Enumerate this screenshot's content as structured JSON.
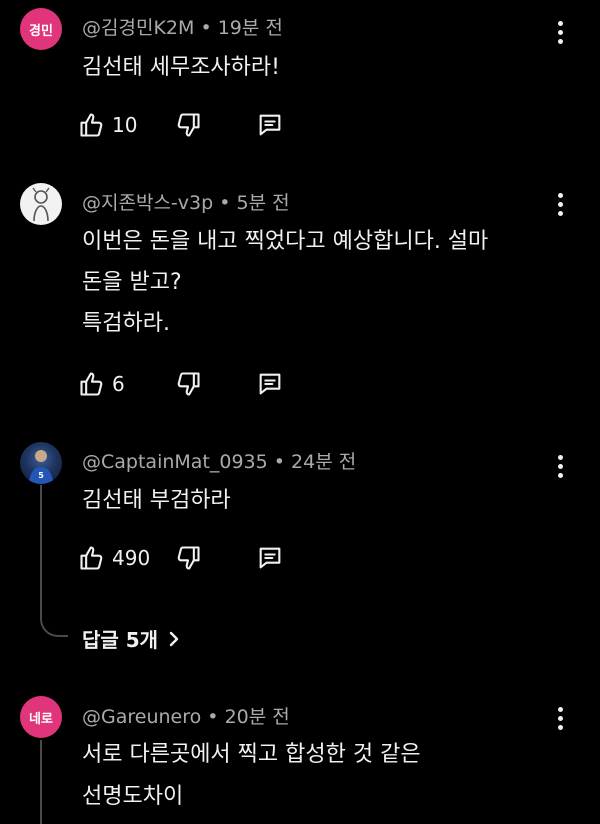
{
  "comments": [
    {
      "avatar_text": "경민",
      "handle": "@김경민K2M",
      "time": "19분 전",
      "lines": [
        "김선태 세무조사하라!"
      ],
      "likes": "10"
    },
    {
      "avatar_text": "",
      "handle": "@지존박스-v3p",
      "time": "5분 전",
      "lines": [
        "이번은 돈을 내고 찍었다고 예상합니다. 설마",
        "돈을 받고?",
        "특검하라."
      ],
      "likes": "6"
    },
    {
      "avatar_text": "",
      "handle": "@CaptainMat_0935",
      "time": "24분 전",
      "lines": [
        "김선태 부검하라"
      ],
      "likes": "490",
      "replies_label": "답글 5개"
    },
    {
      "avatar_text": "네로",
      "handle": "@Gareunero",
      "time": "20분 전",
      "lines": [
        "서로 다른곳에서 찍고 합성한 것 같은",
        "선명도차이"
      ]
    }
  ],
  "separator": "•",
  "icons": {
    "like": "thumbs-up-icon",
    "dislike": "thumbs-down-icon",
    "reply": "comment-icon",
    "more": "more-vert-icon",
    "chevron": "chevron-right-icon"
  },
  "colors": {
    "background": "#000000",
    "text": "#f1f1f1",
    "meta": "#aaaaaa",
    "avatar_pink": "#e0357a"
  }
}
